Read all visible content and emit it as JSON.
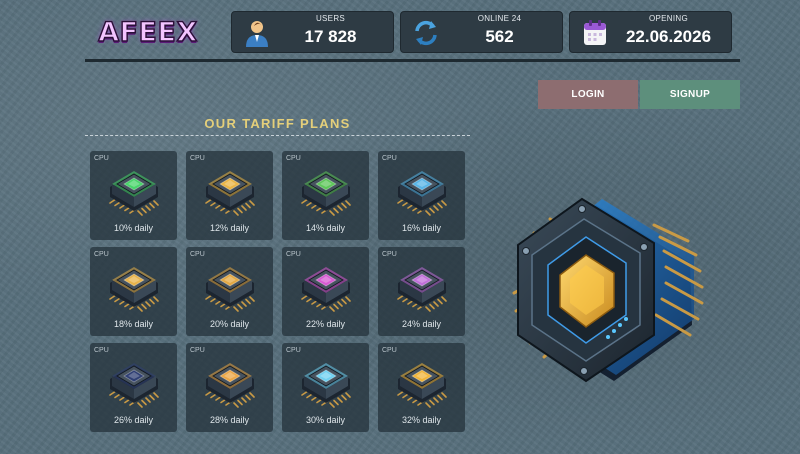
{
  "brand": {
    "logo_text": "AFEEX"
  },
  "stats": [
    {
      "label": "USERS",
      "value": "17 828",
      "icon": "user-icon"
    },
    {
      "label": "ONLINE 24",
      "value": "562",
      "icon": "refresh-arrows-icon"
    },
    {
      "label": "OPENING",
      "value": "22.06.2026",
      "icon": "calendar-icon"
    }
  ],
  "auth": {
    "login_label": "LOGIN",
    "signup_label": "SIGNUP"
  },
  "section": {
    "title": "OUR TARIFF PLANS"
  },
  "plans": [
    {
      "tag": "CPU",
      "rate": "10% daily",
      "accent": "#48d46a"
    },
    {
      "tag": "CPU",
      "rate": "12% daily",
      "accent": "#e9b444"
    },
    {
      "tag": "CPU",
      "rate": "14% daily",
      "accent": "#5ec65a"
    },
    {
      "tag": "CPU",
      "rate": "16% daily",
      "accent": "#58b4e6"
    },
    {
      "tag": "CPU",
      "rate": "18% daily",
      "accent": "#e7b34a"
    },
    {
      "tag": "CPU",
      "rate": "20% daily",
      "accent": "#e3a843"
    },
    {
      "tag": "CPU",
      "rate": "22% daily",
      "accent": "#d75ad2"
    },
    {
      "tag": "CPU",
      "rate": "24% daily",
      "accent": "#c06fd9"
    },
    {
      "tag": "CPU",
      "rate": "26% daily",
      "accent": "#2f3f73"
    },
    {
      "tag": "CPU",
      "rate": "28% daily",
      "accent": "#eaa646"
    },
    {
      "tag": "CPU",
      "rate": "30% daily",
      "accent": "#6fd0f0"
    },
    {
      "tag": "CPU",
      "rate": "32% daily",
      "accent": "#f0b43a"
    }
  ],
  "colors": {
    "background": "#58707d",
    "panel": "#2e3b44",
    "title_gold": "#e4cf7a",
    "login": "#8d6d70",
    "signup": "#5d8f7c"
  }
}
